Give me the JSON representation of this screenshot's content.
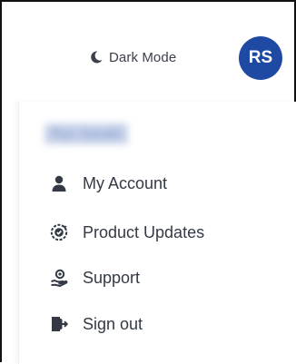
{
  "header": {
    "dark_mode_label": "Dark Mode",
    "dark_mode_icon": "moon-icon",
    "avatar_initials": "RS",
    "avatar_color": "#1f4aa3"
  },
  "menu": {
    "user_name": "Ryu Sasaki",
    "items": [
      {
        "label": "My Account",
        "icon": "user-icon"
      },
      {
        "label": "Product Updates",
        "icon": "product-updates-icon"
      },
      {
        "label": "Support",
        "icon": "support-icon"
      },
      {
        "label": "Sign out",
        "icon": "sign-out-icon"
      }
    ]
  }
}
